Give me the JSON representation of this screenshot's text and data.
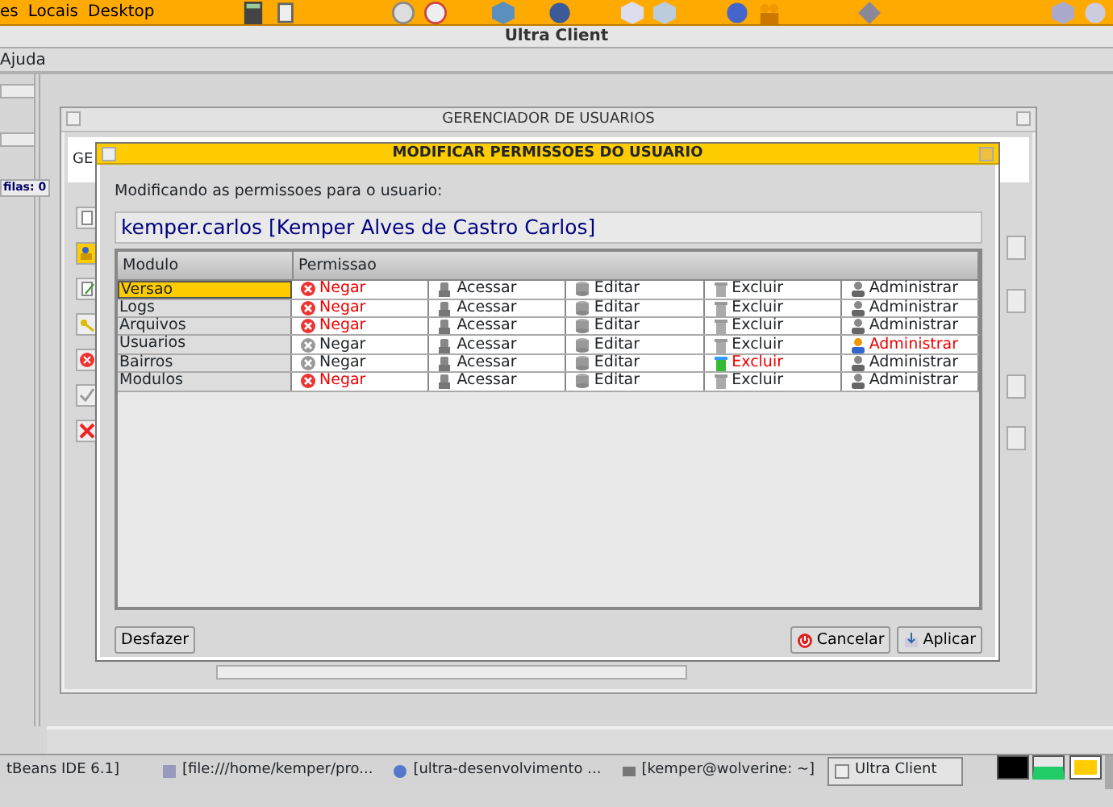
{
  "top_panel": {
    "menus": [
      "es",
      "Locais",
      "Desktop"
    ]
  },
  "window": {
    "title": "Ultra Client",
    "menu": [
      "Ajuda"
    ]
  },
  "side_panel": {
    "label": "filas: 0"
  },
  "manager": {
    "title": "GERENCIADOR DE USUARIOS",
    "label": "GE"
  },
  "dialog": {
    "title": "MODIFICAR PERMISSOES DO USUARIO",
    "prompt": "Modificando as permissoes para o usuario:",
    "user": "kemper.carlos [Kemper Alves de Castro Carlos]",
    "columns": [
      "Modulo",
      "Permissao"
    ],
    "rows": [
      {
        "module": "Versao",
        "selected": true,
        "permissions": [
          {
            "kind": "deny",
            "label": "Negar",
            "selected": true
          },
          {
            "kind": "access",
            "label": "Acessar",
            "selected": false
          },
          {
            "kind": "edit",
            "label": "Editar",
            "selected": false
          },
          {
            "kind": "delete",
            "label": "Excluir",
            "selected": false
          },
          {
            "kind": "admin",
            "label": "Administrar",
            "selected": false
          }
        ]
      },
      {
        "module": "Logs",
        "selected": false,
        "permissions": [
          {
            "kind": "deny",
            "label": "Negar",
            "selected": true
          },
          {
            "kind": "access",
            "label": "Acessar",
            "selected": false
          },
          {
            "kind": "edit",
            "label": "Editar",
            "selected": false
          },
          {
            "kind": "delete",
            "label": "Excluir",
            "selected": false
          },
          {
            "kind": "admin",
            "label": "Administrar",
            "selected": false
          }
        ]
      },
      {
        "module": "Arquivos",
        "selected": false,
        "permissions": [
          {
            "kind": "deny",
            "label": "Negar",
            "selected": true
          },
          {
            "kind": "access",
            "label": "Acessar",
            "selected": false
          },
          {
            "kind": "edit",
            "label": "Editar",
            "selected": false
          },
          {
            "kind": "delete",
            "label": "Excluir",
            "selected": false
          },
          {
            "kind": "admin",
            "label": "Administrar",
            "selected": false
          }
        ]
      },
      {
        "module": "Usuarios",
        "selected": false,
        "permissions": [
          {
            "kind": "deny",
            "label": "Negar",
            "selected": false
          },
          {
            "kind": "access",
            "label": "Acessar",
            "selected": false
          },
          {
            "kind": "edit",
            "label": "Editar",
            "selected": false
          },
          {
            "kind": "delete",
            "label": "Excluir",
            "selected": false
          },
          {
            "kind": "admin",
            "label": "Administrar",
            "selected": true
          }
        ]
      },
      {
        "module": "Bairros",
        "selected": false,
        "permissions": [
          {
            "kind": "deny",
            "label": "Negar",
            "selected": false
          },
          {
            "kind": "access",
            "label": "Acessar",
            "selected": false
          },
          {
            "kind": "edit",
            "label": "Editar",
            "selected": false
          },
          {
            "kind": "delete",
            "label": "Excluir",
            "selected": true
          },
          {
            "kind": "admin",
            "label": "Administrar",
            "selected": false
          }
        ]
      },
      {
        "module": "Modulos",
        "selected": false,
        "permissions": [
          {
            "kind": "deny",
            "label": "Negar",
            "selected": true
          },
          {
            "kind": "access",
            "label": "Acessar",
            "selected": false
          },
          {
            "kind": "edit",
            "label": "Editar",
            "selected": false
          },
          {
            "kind": "delete",
            "label": "Excluir",
            "selected": false
          },
          {
            "kind": "admin",
            "label": "Administrar",
            "selected": false
          }
        ]
      }
    ],
    "left_buttons": [
      {
        "label": "Desfazer"
      }
    ],
    "right_buttons": [
      {
        "kind": "cancel",
        "label": "Cancelar"
      },
      {
        "kind": "apply",
        "label": "Aplicar"
      }
    ]
  },
  "taskbar": {
    "items": [
      {
        "kind": "plain",
        "label": "tBeans IDE 6.1]",
        "selected": false
      },
      {
        "kind": "browser",
        "label": "[file:///home/kemper/pro...",
        "selected": false
      },
      {
        "kind": "tool",
        "label": "[ultra-desenvolvimento ...",
        "selected": false
      },
      {
        "kind": "terminal",
        "label": "[kemper@wolverine: ~]",
        "selected": false
      },
      {
        "kind": "java",
        "label": "Ultra Client",
        "selected": true
      }
    ]
  }
}
